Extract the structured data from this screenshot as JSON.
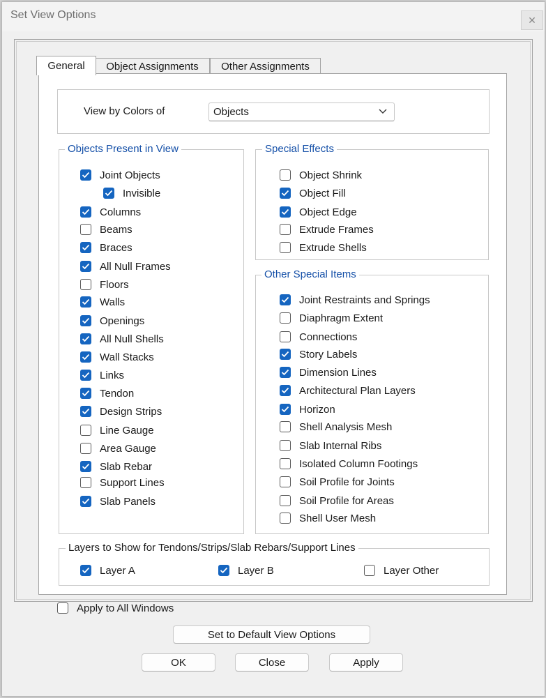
{
  "window": {
    "title": "Set View Options",
    "close_glyph": "✕"
  },
  "tabs": [
    {
      "label": "General",
      "active": true
    },
    {
      "label": "Object Assignments",
      "active": false
    },
    {
      "label": "Other Assignments",
      "active": false
    }
  ],
  "view_by": {
    "label": "View by Colors of",
    "value": "Objects"
  },
  "objects_present": {
    "title": "Objects Present in View",
    "items": [
      {
        "label": "Joint Objects",
        "checked": true
      },
      {
        "label": "Invisible",
        "checked": true
      },
      {
        "label": "Columns",
        "checked": true
      },
      {
        "label": "Beams",
        "checked": false
      },
      {
        "label": "Braces",
        "checked": true
      },
      {
        "label": "All Null Frames",
        "checked": true
      },
      {
        "label": "Floors",
        "checked": false
      },
      {
        "label": "Walls",
        "checked": true
      },
      {
        "label": "Openings",
        "checked": true
      },
      {
        "label": "All Null Shells",
        "checked": true
      },
      {
        "label": "Wall Stacks",
        "checked": true
      },
      {
        "label": "Links",
        "checked": true
      },
      {
        "label": "Tendon",
        "checked": true
      },
      {
        "label": "Design Strips",
        "checked": true
      },
      {
        "label": "Line Gauge",
        "checked": false
      },
      {
        "label": "Area Gauge",
        "checked": false
      },
      {
        "label": "Slab Rebar",
        "checked": true
      },
      {
        "label": "Support Lines",
        "checked": false
      },
      {
        "label": "Slab Panels",
        "checked": true
      }
    ]
  },
  "special_effects": {
    "title": "Special Effects",
    "items": [
      {
        "label": "Object Shrink",
        "checked": false
      },
      {
        "label": "Object Fill",
        "checked": true
      },
      {
        "label": "Object Edge",
        "checked": true
      },
      {
        "label": "Extrude Frames",
        "checked": false
      },
      {
        "label": "Extrude Shells",
        "checked": false
      }
    ]
  },
  "other_special": {
    "title": "Other Special Items",
    "items": [
      {
        "label": "Joint Restraints and Springs",
        "checked": true
      },
      {
        "label": "Diaphragm Extent",
        "checked": false
      },
      {
        "label": "Connections",
        "checked": false
      },
      {
        "label": "Story Labels",
        "checked": true
      },
      {
        "label": "Dimension Lines",
        "checked": true
      },
      {
        "label": "Architectural Plan Layers",
        "checked": true
      },
      {
        "label": "Horizon",
        "checked": true
      },
      {
        "label": "Shell Analysis Mesh",
        "checked": false
      },
      {
        "label": "Slab Internal Ribs",
        "checked": false
      },
      {
        "label": "Isolated Column Footings",
        "checked": false
      },
      {
        "label": "Soil Profile for Joints",
        "checked": false
      },
      {
        "label": "Soil Profile for Areas",
        "checked": false
      },
      {
        "label": "Shell User Mesh",
        "checked": false
      }
    ]
  },
  "layers": {
    "title": "Layers to Show for Tendons/Strips/Slab Rebars/Support Lines",
    "items": [
      {
        "label": "Layer A",
        "checked": true
      },
      {
        "label": "Layer B",
        "checked": true
      },
      {
        "label": "Layer Other",
        "checked": false
      }
    ]
  },
  "apply_all": {
    "label": "Apply to All Windows",
    "checked": false
  },
  "buttons": {
    "default": "Set to Default View Options",
    "ok": "OK",
    "close": "Close",
    "apply": "Apply"
  },
  "colors": {
    "accent": "#1565c0",
    "group_title": "#1550a8"
  }
}
